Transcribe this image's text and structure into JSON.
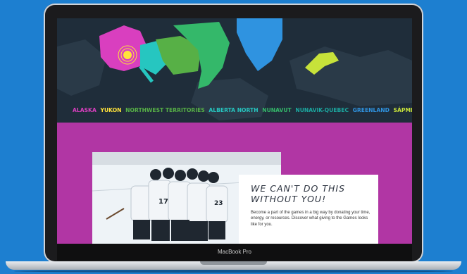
{
  "device": {
    "bezel_label": "MacBook Pro"
  },
  "map": {
    "regions": [
      {
        "label": "ALASKA",
        "color": "#d93fbf"
      },
      {
        "label": "YUKON",
        "color": "#ffe23a"
      },
      {
        "label": "NORTHWEST TERRITORIES",
        "color": "#57b046"
      },
      {
        "label": "ALBERTA NORTH",
        "color": "#26c6c0"
      },
      {
        "label": "NUNAVUT",
        "color": "#34b86a"
      },
      {
        "label": "NUNAVIK-QUEBEC",
        "color": "#1ba8a0"
      },
      {
        "label": "GREENLAND",
        "color": "#2f93e0"
      },
      {
        "label": "SÁPMI",
        "color": "#c7e23a"
      }
    ]
  },
  "promo": {
    "title": "WE CAN'T DO THIS WITHOUT YOU!",
    "body": "Become a part of the games in a big way by donating your time, energy, or resources. Discover what giving to the Games looks like for you."
  },
  "colors": {
    "background": "#1d7fd0",
    "magenta": "#b136a4",
    "map_bg": "#1f2d3a"
  }
}
